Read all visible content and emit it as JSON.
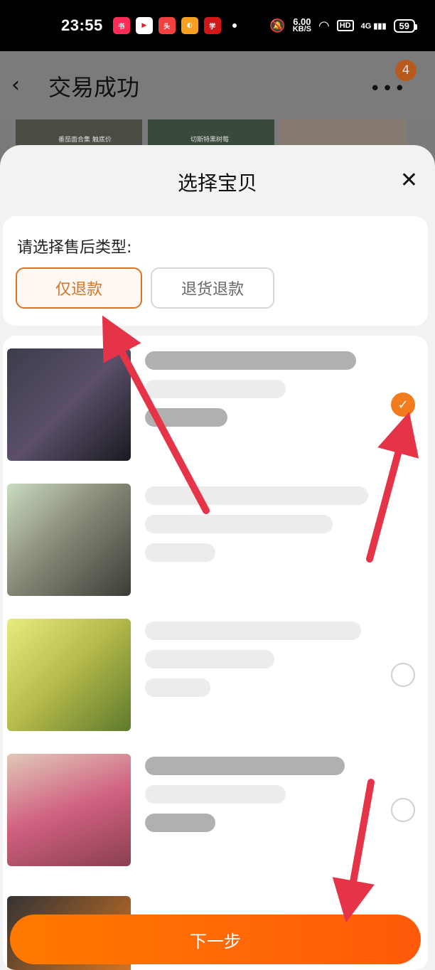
{
  "status_bar": {
    "time": "23:55",
    "app_icons": [
      "小红书-icon",
      "video-icon",
      "头条-icon",
      "photo-icon",
      "学习-icon"
    ],
    "net_speed": "6.00",
    "net_speed_unit": "KB/S",
    "hd": "HD",
    "signal_label": "4G",
    "battery": "59"
  },
  "background_page": {
    "title": "交易成功",
    "badge_count": "4",
    "thumb_captions": [
      "番茄面合集 触底价",
      "切斯特黑树莓",
      ""
    ]
  },
  "sheet": {
    "title": "选择宝贝",
    "type_label": "请选择售后类型:",
    "types": [
      {
        "label": "仅退款",
        "selected": true
      },
      {
        "label": "退货退款",
        "selected": false
      }
    ],
    "products": [
      {
        "selected": true,
        "image_colors": [
          "#3b3d4a",
          "#5b4f6a",
          "#1a1a1f"
        ]
      },
      {
        "selected": false,
        "image_colors": [
          "#8a8a7a",
          "#5b5f4e",
          "#3c3c36"
        ]
      },
      {
        "selected": false,
        "image_colors": [
          "#d4d84a",
          "#b3b84a",
          "#5d7a2c"
        ]
      },
      {
        "selected": false,
        "image_colors": [
          "#e0c8b8",
          "#d06080",
          "#8a4050"
        ]
      }
    ],
    "next_label": "下一步"
  },
  "colors": {
    "accent": "#f27b1e",
    "button_gradient_start": "#ff7a00",
    "button_gradient_end": "#ff5a0a",
    "arrow": "#e53348"
  }
}
